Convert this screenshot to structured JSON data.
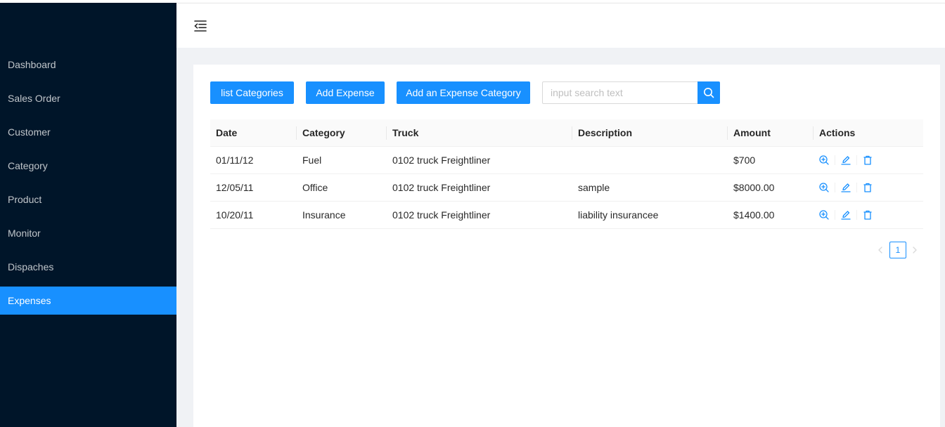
{
  "sidebar": {
    "items": [
      {
        "label": "Dashboard"
      },
      {
        "label": "Sales Order"
      },
      {
        "label": "Customer"
      },
      {
        "label": "Category"
      },
      {
        "label": "Product"
      },
      {
        "label": "Monitor"
      },
      {
        "label": "Dispaches"
      },
      {
        "label": "Expenses"
      }
    ],
    "selected": "Expenses"
  },
  "header": {
    "trigger_icon": "menu-fold-icon"
  },
  "toolbar": {
    "list_categories_label": "list Categories",
    "add_expense_label": "Add Expense",
    "add_category_label": "Add an Expense Category",
    "search_placeholder": "input search text",
    "search_value": "",
    "search_icon": "search-icon"
  },
  "table": {
    "columns": [
      "Date",
      "Category",
      "Truck",
      "Description",
      "Amount",
      "Actions"
    ],
    "rows": [
      {
        "date": "01/11/12",
        "category": "Fuel",
        "truck": "0102 truck Freightliner",
        "description": "",
        "amount": "$700"
      },
      {
        "date": "12/05/11",
        "category": "Office",
        "truck": "0102 truck Freightliner",
        "description": "sample",
        "amount": "$8000.00"
      },
      {
        "date": "10/20/11",
        "category": "Insurance",
        "truck": "0102 truck Freightliner",
        "description": "liability insurancee",
        "amount": "$1400.00"
      }
    ],
    "row_actions": [
      "zoom-in-icon",
      "edit-icon",
      "delete-icon"
    ]
  },
  "pagination": {
    "current": "1"
  },
  "colors": {
    "primary": "#1890ff",
    "sider": "#001529",
    "content_bg": "#f0f2f5"
  }
}
